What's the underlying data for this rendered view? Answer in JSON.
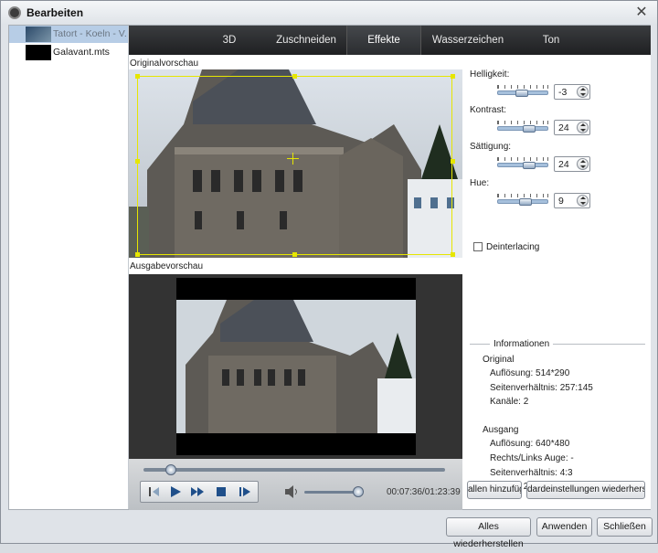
{
  "window": {
    "title": "Bearbeiten",
    "close_glyph": "✕"
  },
  "files": [
    {
      "name": "Tatort - Koeln - V...",
      "selected": true
    },
    {
      "name": "Galavant.mts",
      "selected": false
    }
  ],
  "tabs": [
    {
      "label": "3D",
      "active": false
    },
    {
      "label": "Zuschneiden",
      "active": false
    },
    {
      "label": "Effekte",
      "active": true
    },
    {
      "label": "Wasserzeichen",
      "active": false
    },
    {
      "label": "Ton",
      "active": false
    }
  ],
  "preview": {
    "original_label": "Originalvorschau",
    "output_label": "Ausgabevorschau"
  },
  "player": {
    "progress_fraction": 0.09,
    "volume_fraction": 0.92,
    "time": "00:07:36/01:23:39"
  },
  "effects": {
    "brightness": {
      "label": "Helligkeit:",
      "value": "-3",
      "slider_fraction": 0.48
    },
    "contrast": {
      "label": "Kontrast:",
      "value": "24",
      "slider_fraction": 0.62
    },
    "saturation": {
      "label": "Sättigung:",
      "value": "24",
      "slider_fraction": 0.62
    },
    "hue": {
      "label": "Hue:",
      "value": "9",
      "slider_fraction": 0.55
    },
    "deinterlacing_label": "Deinterlacing",
    "deinterlacing_checked": false
  },
  "info": {
    "title": "Informationen",
    "original_heading": "Original",
    "original_resolution": "Auflösung: 514*290",
    "original_aspect": "Seitenverhältnis: 257:145",
    "original_channels": "Kanäle: 2",
    "output_heading": "Ausgang",
    "output_resolution": "Auflösung: 640*480",
    "output_eye": "Rechts/Links Auge: -",
    "output_aspect": "Seitenverhältnis: 4:3",
    "output_channels": "Kanäle: 2"
  },
  "panel_buttons": {
    "apply_all": "allen hinzufüg",
    "restore_defaults": "dardeinstellungen wiederherst"
  },
  "footer": {
    "restore_all": "Alles wiederherstellen",
    "apply": "Anwenden",
    "close": "Schließen"
  }
}
